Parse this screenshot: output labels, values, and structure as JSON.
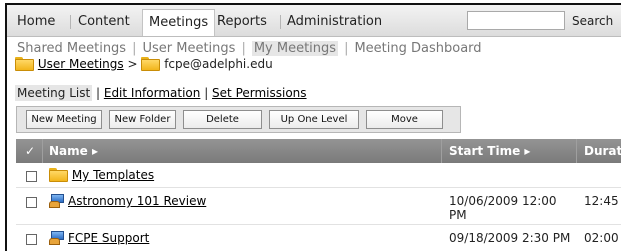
{
  "topnav": {
    "tabs": [
      "Home",
      "Content",
      "Meetings",
      "Reports",
      "Administration"
    ],
    "active_tab": "Meetings",
    "search_placeholder": "",
    "search_button": "Search"
  },
  "subnav": [
    "Shared Meetings",
    "User Meetings",
    "My Meetings",
    "Meeting Dashboard"
  ],
  "subnav_current": "My Meetings",
  "breadcrumb": {
    "root": "User Meetings",
    "separator": ">",
    "current": "fcpe@adelphi.edu"
  },
  "tabs": {
    "selected": "Meeting List",
    "others": [
      "Edit Information",
      "Set Permissions"
    ]
  },
  "toolbar": {
    "new_meeting": "New Meeting",
    "new_folder": "New Folder",
    "delete": "Delete",
    "up_one_level": "Up One Level",
    "move": "Move"
  },
  "grid": {
    "check_header": "✓",
    "columns": {
      "name": "Name ▸",
      "start": "Start Time ▸",
      "duration": "Duration"
    },
    "rows": [
      {
        "icon": "folder-icon",
        "name": "My Templates",
        "start": "",
        "duration": ""
      },
      {
        "icon": "meeting-icon",
        "name": "Astronomy 101 Review",
        "start": "10/06/2009 12:00 PM",
        "duration": "12:45"
      },
      {
        "icon": "meeting-icon",
        "name": "FCPE Support",
        "start": "09/18/2009 2:30 PM",
        "duration": "02:00"
      }
    ]
  }
}
